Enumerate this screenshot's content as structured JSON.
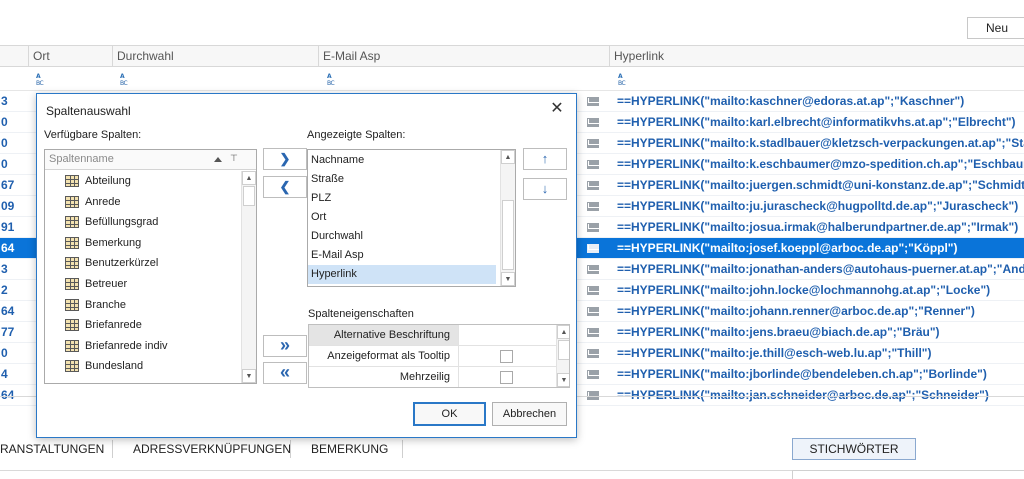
{
  "toolbar": {
    "new_label": "Neu"
  },
  "grid": {
    "columns": [
      {
        "label": "Ort"
      },
      {
        "label": "Durchwahl"
      },
      {
        "label": "E-Mail Asp"
      },
      {
        "label": "Hyperlink"
      }
    ],
    "filter_icon_text": "ABC",
    "rows": [
      {
        "num": "3",
        "hyperlink": "==HYPERLINK(\"mailto:kaschner@edoras.at.ap\";\"Kaschner\")",
        "selected": false
      },
      {
        "num": "0",
        "hyperlink": "==HYPERLINK(\"mailto:karl.elbrecht@informatikvhs.at.ap\";\"Elbrecht\")",
        "selected": false
      },
      {
        "num": "0",
        "hyperlink": "==HYPERLINK(\"mailto:k.stadlbauer@kletzsch-verpackungen.at.ap\";\"Stadlbauer\")",
        "selected": false
      },
      {
        "num": "0",
        "hyperlink": "==HYPERLINK(\"mailto:k.eschbaumer@mzo-spedition.ch.ap\";\"Eschbaumer\")",
        "selected": false
      },
      {
        "num": "67",
        "hyperlink": "==HYPERLINK(\"mailto:juergen.schmidt@uni-konstanz.de.ap\";\"Schmidt\")",
        "selected": false
      },
      {
        "num": "09",
        "hyperlink": "==HYPERLINK(\"mailto:ju.jurascheck@hugpolltd.de.ap\";\"Jurascheck\")",
        "selected": false
      },
      {
        "num": "91",
        "hyperlink": "==HYPERLINK(\"mailto:josua.irmak@halberundpartner.de.ap\";\"Irmak\")",
        "selected": false
      },
      {
        "num": "64",
        "hyperlink": "==HYPERLINK(\"mailto:josef.koeppl@arboc.de.ap\";\"Köppl\")",
        "selected": true
      },
      {
        "num": "3",
        "hyperlink": "==HYPERLINK(\"mailto:jonathan-anders@autohaus-puerner.at.ap\";\"Anders\")",
        "selected": false
      },
      {
        "num": "2",
        "hyperlink": "==HYPERLINK(\"mailto:john.locke@lochmannohg.at.ap\";\"Locke\")",
        "selected": false
      },
      {
        "num": "64",
        "hyperlink": "==HYPERLINK(\"mailto:johann.renner@arboc.de.ap\";\"Renner\")",
        "selected": false
      },
      {
        "num": "77",
        "hyperlink": "==HYPERLINK(\"mailto:jens.braeu@biach.de.ap\";\"Bräu\")",
        "selected": false
      },
      {
        "num": "0",
        "hyperlink": "==HYPERLINK(\"mailto:je.thill@esch-web.lu.ap\";\"Thill\")",
        "selected": false
      },
      {
        "num": "4",
        "hyperlink": "==HYPERLINK(\"mailto:jborlinde@bendeleben.ch.ap\";\"Borlinde\")",
        "selected": false
      },
      {
        "num": "64",
        "hyperlink": "==HYPERLINK(\"mailto:jan.schneider@arboc.de.ap\";\"Schneider\")",
        "selected": false
      }
    ]
  },
  "tabs": [
    {
      "label": "RANSTALTUNGEN"
    },
    {
      "label": "ADRESSVERKNÜPFUNGEN"
    },
    {
      "label": "BEMERKUNG"
    }
  ],
  "stichwoerter_label": "STICHWÖRTER",
  "dialog": {
    "title": "Spaltenauswahl",
    "close_glyph": "✕",
    "available_label": "Verfügbare Spalten:",
    "displayed_label": "Angezeigte Spalten:",
    "column_name_placeholder": "Spaltenname",
    "filter_glyph": "⊤",
    "available": [
      "Abteilung",
      "Anrede",
      "Befüllungsgrad",
      "Bemerkung",
      "Benutzerkürzel",
      "Betreuer",
      "Branche",
      "Briefanrede",
      "Briefanrede indiv",
      "Bundesland"
    ],
    "displayed": [
      {
        "label": "Nachname",
        "selected": false
      },
      {
        "label": "Straße",
        "selected": false
      },
      {
        "label": "PLZ",
        "selected": false
      },
      {
        "label": "Ort",
        "selected": false
      },
      {
        "label": "Durchwahl",
        "selected": false
      },
      {
        "label": "E-Mail Asp",
        "selected": false
      },
      {
        "label": "Hyperlink",
        "selected": true
      }
    ],
    "buttons": {
      "add": "❯",
      "remove": "❮",
      "add_all": "»",
      "remove_all": "«",
      "up": "↑",
      "down": "↓",
      "ok": "OK",
      "cancel": "Abbrechen"
    },
    "properties_label": "Spalteneigenschaften",
    "properties": [
      {
        "label": "Alternative Beschriftung",
        "checkbox": false
      },
      {
        "label": "Anzeigeformat als Tooltip",
        "checkbox": true
      },
      {
        "label": "Mehrzeilig",
        "checkbox": true
      }
    ]
  }
}
